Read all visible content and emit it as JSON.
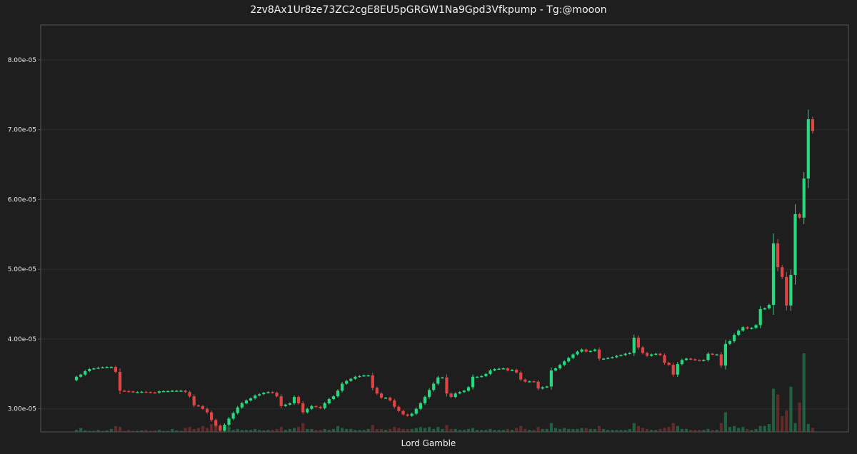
{
  "chart_data": {
    "type": "candlestick",
    "title": "2zv8Ax1Ur8ze73ZC2cgE8EU5pGRGW1Na9Gpd3Vfkpump - Tg:@mooon",
    "xlabel": "Lord Gamble",
    "ylabel": "",
    "ylim": [
      2.67e-05,
      8.5e-05
    ],
    "yticks": [
      "3.00e-05",
      "4.00e-05",
      "5.00e-05",
      "6.00e-05",
      "7.00e-05",
      "8.00e-05"
    ],
    "ytick_values": [
      3e-05,
      4e-05,
      5e-05,
      6e-05,
      7e-05,
      8e-05
    ],
    "grid": true,
    "colors": {
      "up": "#26d97f",
      "down": "#e04545",
      "background": "#1e1e1e",
      "grid": "#2c2c2c",
      "axis": "#555555"
    },
    "closes": [
      3.46e-05,
      3.49e-05,
      3.54e-05,
      3.57e-05,
      3.58e-05,
      3.59e-05,
      3.595e-05,
      3.6e-05,
      3.6e-05,
      3.53e-05,
      3.26e-05,
      3.255e-05,
      3.25e-05,
      3.24e-05,
      3.24e-05,
      3.245e-05,
      3.24e-05,
      3.235e-05,
      3.23e-05,
      3.25e-05,
      3.255e-05,
      3.255e-05,
      3.26e-05,
      3.26e-05,
      3.26e-05,
      3.24e-05,
      3.18e-05,
      3.05e-05,
      3.04e-05,
      3e-05,
      2.95e-05,
      2.84e-05,
      2.76e-05,
      2.69e-05,
      2.77e-05,
      2.86e-05,
      2.94e-05,
      3.02e-05,
      3.08e-05,
      3.12e-05,
      3.15e-05,
      3.19e-05,
      3.21e-05,
      3.23e-05,
      3.24e-05,
      3.23e-05,
      3.18e-05,
      3.04e-05,
      3.06e-05,
      3.08e-05,
      3.17e-05,
      3.08e-05,
      2.95e-05,
      3e-05,
      3.04e-05,
      3.03e-05,
      3.01e-05,
      3.08e-05,
      3.14e-05,
      3.18e-05,
      3.26e-05,
      3.36e-05,
      3.4e-05,
      3.43e-05,
      3.46e-05,
      3.47e-05,
      3.48e-05,
      3.48e-05,
      3.3e-05,
      3.22e-05,
      3.16e-05,
      3.16e-05,
      3.12e-05,
      3.03e-05,
      2.97e-05,
      2.92e-05,
      2.9e-05,
      2.93e-05,
      3e-05,
      3.08e-05,
      3.17e-05,
      3.27e-05,
      3.36e-05,
      3.45e-05,
      3.45e-05,
      3.22e-05,
      3.17e-05,
      3.22e-05,
      3.24e-05,
      3.26e-05,
      3.31e-05,
      3.46e-05,
      3.46e-05,
      3.47e-05,
      3.5e-05,
      3.55e-05,
      3.57e-05,
      3.575e-05,
      3.58e-05,
      3.55e-05,
      3.56e-05,
      3.52e-05,
      3.42e-05,
      3.39e-05,
      3.395e-05,
      3.39e-05,
      3.29e-05,
      3.31e-05,
      3.32e-05,
      3.55e-05,
      3.58e-05,
      3.63e-05,
      3.68e-05,
      3.73e-05,
      3.78e-05,
      3.82e-05,
      3.85e-05,
      3.82e-05,
      3.83e-05,
      3.85e-05,
      3.72e-05,
      3.72e-05,
      3.73e-05,
      3.74e-05,
      3.76e-05,
      3.77e-05,
      3.79e-05,
      3.8e-05,
      4.02e-05,
      3.88e-05,
      3.8e-05,
      3.76e-05,
      3.78e-05,
      3.79e-05,
      3.77e-05,
      3.66e-05,
      3.63e-05,
      3.49e-05,
      3.64e-05,
      3.7e-05,
      3.72e-05,
      3.71e-05,
      3.7e-05,
      3.69e-05,
      3.7e-05,
      3.79e-05,
      3.78e-05,
      3.78e-05,
      3.62e-05,
      3.93e-05,
      3.97e-05,
      4.06e-05,
      4.12e-05,
      4.17e-05,
      4.15e-05,
      4.16e-05,
      4.2e-05,
      4.43e-05,
      4.44e-05,
      4.49e-05,
      5.37e-05,
      5.03e-05,
      4.89e-05,
      4.48e-05,
      4.92e-05,
      5.79e-05,
      5.74e-05,
      6.3e-05,
      7.15e-05,
      6.98e-05
    ],
    "volume": [
      0.2,
      0.4,
      0.15,
      0.1,
      0.1,
      0.2,
      0.1,
      0.15,
      0.3,
      0.6,
      0.5,
      0.1,
      0.2,
      0.1,
      0.1,
      0.15,
      0.2,
      0.1,
      0.15,
      0.2,
      0.1,
      0.1,
      0.3,
      0.15,
      0.1,
      0.4,
      0.5,
      0.3,
      0.4,
      0.6,
      0.4,
      0.8,
      0.7,
      0.6,
      0.4,
      0.5,
      0.2,
      0.3,
      0.2,
      0.2,
      0.2,
      0.3,
      0.2,
      0.15,
      0.2,
      0.2,
      0.3,
      0.5,
      0.2,
      0.3,
      0.4,
      0.5,
      0.9,
      0.3,
      0.3,
      0.2,
      0.2,
      0.3,
      0.2,
      0.3,
      0.6,
      0.4,
      0.3,
      0.3,
      0.2,
      0.2,
      0.2,
      0.3,
      0.7,
      0.3,
      0.3,
      0.2,
      0.3,
      0.5,
      0.4,
      0.3,
      0.3,
      0.3,
      0.4,
      0.5,
      0.4,
      0.5,
      0.3,
      0.5,
      0.3,
      0.7,
      0.3,
      0.3,
      0.2,
      0.2,
      0.3,
      0.4,
      0.2,
      0.2,
      0.2,
      0.3,
      0.2,
      0.2,
      0.2,
      0.3,
      0.2,
      0.4,
      0.6,
      0.3,
      0.2,
      0.2,
      0.5,
      0.3,
      0.3,
      0.9,
      0.4,
      0.3,
      0.4,
      0.3,
      0.3,
      0.3,
      0.4,
      0.4,
      0.3,
      0.3,
      0.6,
      0.3,
      0.2,
      0.2,
      0.2,
      0.2,
      0.2,
      0.3,
      0.9,
      0.6,
      0.4,
      0.3,
      0.2,
      0.2,
      0.3,
      0.4,
      0.5,
      0.9,
      0.6,
      0.3,
      0.3,
      0.2,
      0.2,
      0.2,
      0.2,
      0.3,
      0.2,
      0.2,
      0.9,
      2.0,
      0.5,
      0.6,
      0.4,
      0.5,
      0.3,
      0.2,
      0.3,
      0.6,
      0.6,
      0.8,
      4.4,
      3.8,
      1.6,
      2.2,
      4.6,
      0.9,
      3.0,
      8.0,
      0.8,
      0.4
    ]
  }
}
